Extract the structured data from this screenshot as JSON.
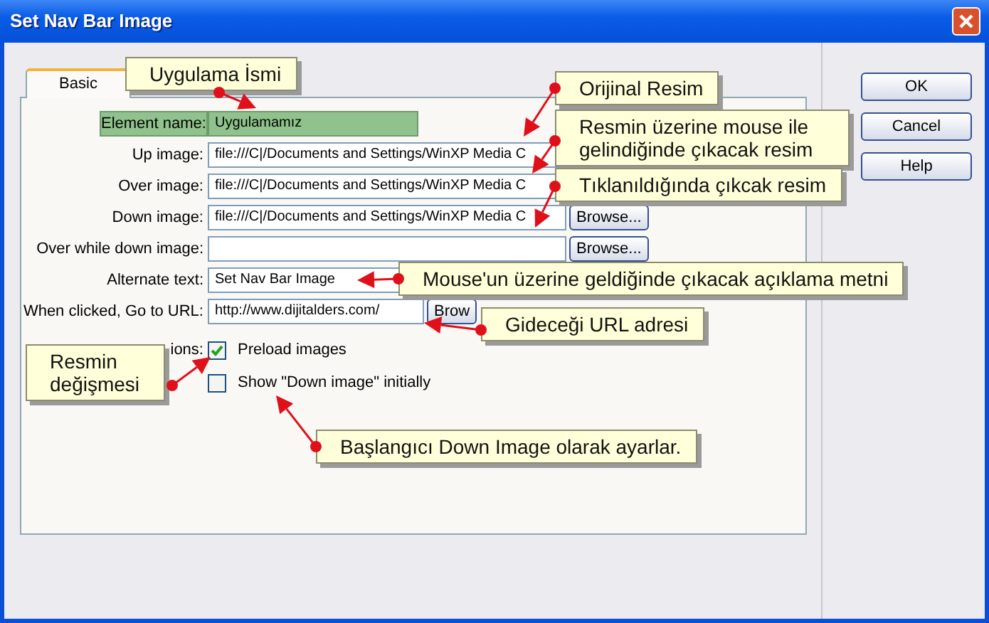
{
  "window": {
    "title": "Set Nav Bar Image"
  },
  "tabs": [
    {
      "label": "Basic",
      "selected": true
    }
  ],
  "element_name": {
    "label": "Element name:",
    "value": "Uygulamamız",
    "highlighted": true
  },
  "fields": [
    {
      "kind": "file",
      "label": "Up image:",
      "value": "file:///C|/Documents and Settings/WinXP Media C"
    },
    {
      "kind": "file",
      "label": "Over image:",
      "value": "file:///C|/Documents and Settings/WinXP Media C"
    },
    {
      "kind": "file",
      "label": "Down image:",
      "value": "file:///C|/Documents and Settings/WinXP Media C",
      "button": "Browse..."
    },
    {
      "kind": "file",
      "label": "Over while down image:",
      "button": "Browse..."
    },
    {
      "kind": "file",
      "label": "Alternate text:",
      "value": "Set Nav Bar Image"
    },
    {
      "kind": "url",
      "label": "When clicked, Go to URL:",
      "value": "http://www.dijitalders.com/",
      "button": "Brow"
    }
  ],
  "options": {
    "label": "ions:",
    "checkboxes": [
      {
        "label": "Preload images",
        "checked": true
      },
      {
        "label": "Show \"Down image\" initially",
        "checked": false
      }
    ]
  },
  "buttons": [
    "OK",
    "Cancel",
    "Help"
  ],
  "callouts": [
    "Uygulama İsmi",
    "Orijinal Resim",
    "Resmin üzerine mouse ile gelindiğinde çıkacak resim",
    "Tıklanıldığında çıkcak resim",
    "Mouse'un üzerine geldiğinde çıkacak açıklama metni",
    "Gideceği URL adresi",
    "Resmin değişmesi",
    "Başlangıcı Down Image olarak ayarlar."
  ]
}
